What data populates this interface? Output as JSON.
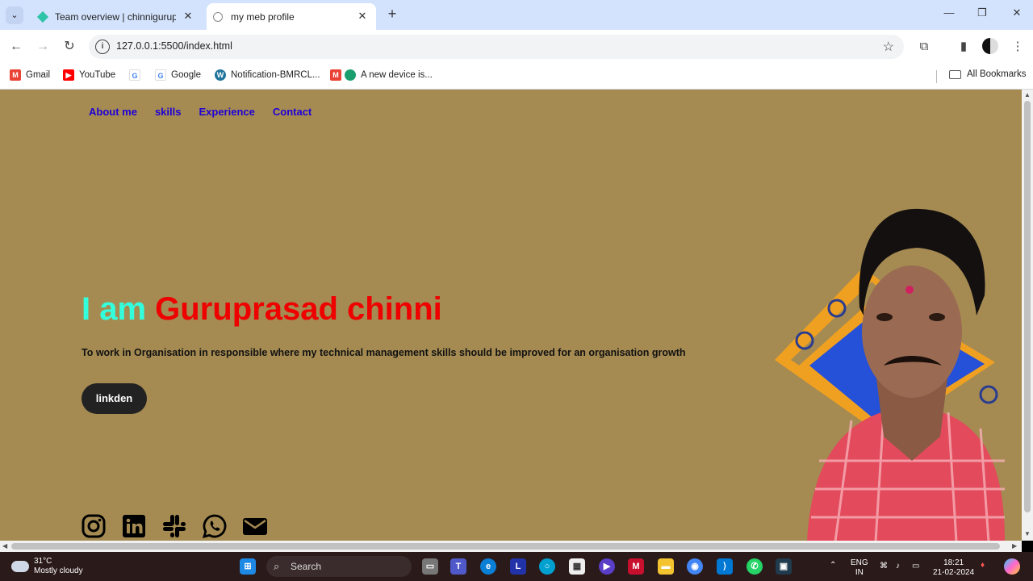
{
  "browser": {
    "tabs": [
      {
        "title": "Team overview | chinniguruprasad",
        "active": false
      },
      {
        "title": "my meb profile",
        "active": true
      }
    ],
    "address": "127.0.0.1:5500/index.html",
    "bookmarks": [
      {
        "label": "Gmail",
        "icon": "gmail-icon",
        "color": "#ea4335"
      },
      {
        "label": "YouTube",
        "icon": "youtube-icon",
        "color": "#ff0000"
      },
      {
        "label": "",
        "icon": "google-icon",
        "color": "#4285f4"
      },
      {
        "label": "Google",
        "icon": "google-icon",
        "color": "#4285f4"
      },
      {
        "label": "Notification-BMRCL...",
        "icon": "wordpress-icon",
        "color": "#21759b"
      },
      {
        "label": "A new device is...",
        "icon": "gmail-icon",
        "color": "#ea4335"
      }
    ],
    "all_bookmarks": "All Bookmarks"
  },
  "page": {
    "nav": [
      "About me",
      "skills",
      "Experience",
      "Contact"
    ],
    "hero": {
      "prefix": "I am",
      "name": "Guruprasad chinni",
      "tagline": "To work in Organisation in responsible where my technical management skills should be improved for an organisation growth",
      "button": "linkden"
    },
    "socials": [
      "instagram-icon",
      "linkedin-icon",
      "slack-icon",
      "whatsapp-icon",
      "email-icon"
    ],
    "colors": {
      "background": "#a58b52",
      "nav_link": "#1e00d6",
      "prefix": "#33ffdd",
      "name": "#ef0000",
      "button": "#222222"
    }
  },
  "taskbar": {
    "weather_temp": "31°C",
    "weather_desc": "Mostly cloudy",
    "search": "Search",
    "lang1": "ENG",
    "lang2": "IN",
    "time": "18:21",
    "date": "21-02-2024"
  }
}
